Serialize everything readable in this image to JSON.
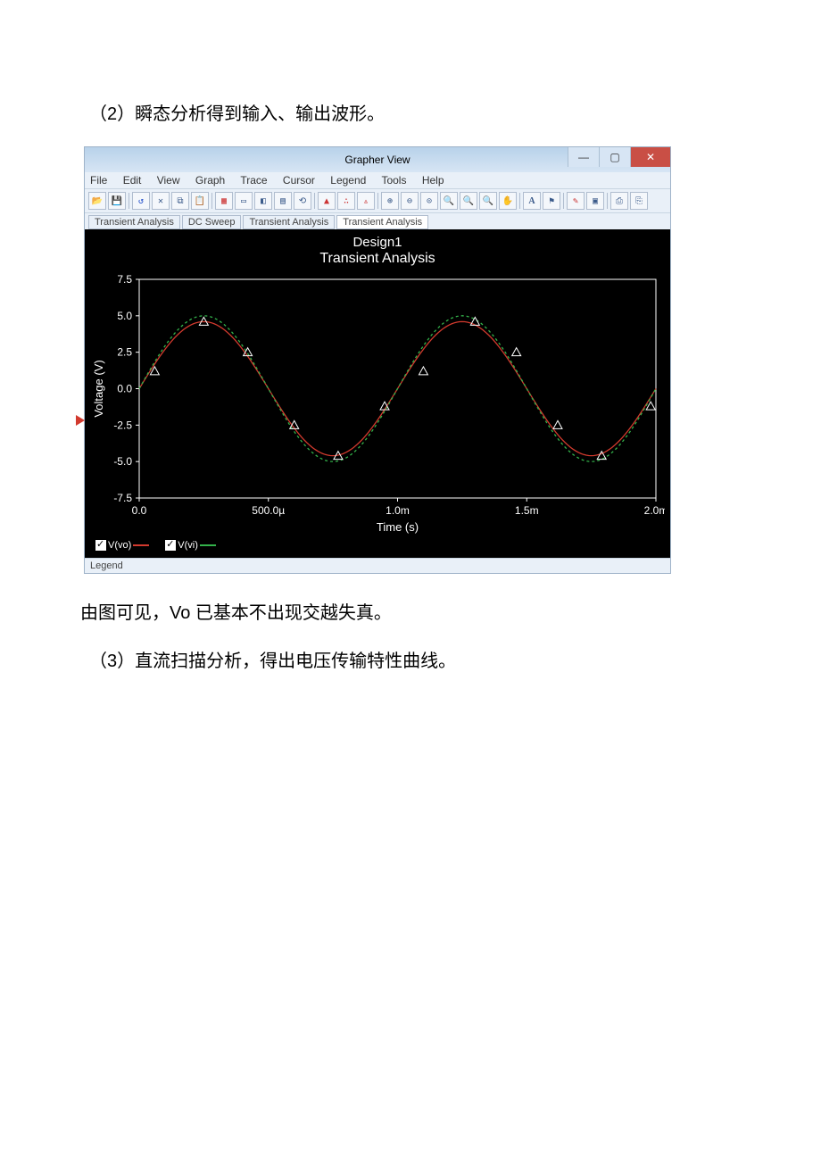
{
  "paragraphs": {
    "p1": "（2）瞬态分析得到输入、输出波形。",
    "p2": "由图可见，Vo 已基本不出现交越失真。",
    "p3": "（3）直流扫描分析，得出电压传输特性曲线。"
  },
  "window": {
    "title": "Grapher View",
    "min": "—",
    "max": "▢",
    "close": "✕",
    "menu": {
      "file": "File",
      "edit": "Edit",
      "view": "View",
      "graph": "Graph",
      "trace": "Trace",
      "cursor": "Cursor",
      "legend": "Legend",
      "tools": "Tools",
      "help": "Help"
    },
    "tabs": {
      "t1": "Transient Analysis",
      "t2": "DC Sweep",
      "t3": "Transient Analysis",
      "t4": "Transient Analysis"
    },
    "legend_status": "Legend"
  },
  "chart_data": {
    "type": "line",
    "title": "Design1",
    "subtitle": "Transient Analysis",
    "xlabel": "Time (s)",
    "ylabel": "Voltage (V)",
    "xlim": [
      0,
      0.002
    ],
    "ylim": [
      -7.5,
      7.5
    ],
    "xticks": {
      "values": [
        0,
        0.0005,
        0.001,
        0.0015,
        0.002
      ],
      "labels": [
        "0.0",
        "500.0µ",
        "1.0m",
        "1.5m",
        "2.0m"
      ]
    },
    "yticks": {
      "values": [
        -7.5,
        -5,
        -2.5,
        0,
        2.5,
        5,
        7.5
      ],
      "labels": [
        "-7.5",
        "-5.0",
        "-2.5",
        "0.0",
        "2.5",
        "5.0",
        "7.5"
      ]
    },
    "series": [
      {
        "name": "V(vo)",
        "color": "#d23a2e",
        "dashed": false,
        "x": [
          0,
          0.000125,
          0.00025,
          0.000375,
          0.0005,
          0.000625,
          0.00075,
          0.000875,
          0.001,
          0.001125,
          0.00125,
          0.001375,
          0.0015,
          0.001625,
          0.00175,
          0.001875,
          0.002
        ],
        "y": [
          0,
          3.3,
          4.6,
          3.3,
          0,
          -3.3,
          -4.6,
          -3.3,
          0,
          3.3,
          4.6,
          3.3,
          0,
          -3.3,
          -4.6,
          -3.3,
          0
        ]
      },
      {
        "name": "V(vi)",
        "color": "#33b24a",
        "dashed": true,
        "x": [
          0,
          0.000125,
          0.00025,
          0.000375,
          0.0005,
          0.000625,
          0.00075,
          0.000875,
          0.001,
          0.001125,
          0.00125,
          0.001375,
          0.0015,
          0.001625,
          0.00175,
          0.001875,
          0.002
        ],
        "y": [
          0,
          3.5,
          5.0,
          3.5,
          0,
          -3.5,
          -5.0,
          -3.5,
          0,
          3.5,
          5.0,
          3.5,
          0,
          -3.5,
          -5.0,
          -3.5,
          0
        ]
      }
    ],
    "markers": {
      "color": "#fff",
      "x": [
        6e-05,
        0.00025,
        0.00042,
        0.0006,
        0.00077,
        0.00095,
        0.0011,
        0.0013,
        0.00146,
        0.00162,
        0.00179,
        0.00198
      ],
      "y": [
        1.2,
        4.6,
        2.5,
        -2.5,
        -4.6,
        -1.2,
        1.2,
        4.6,
        2.5,
        -2.5,
        -4.6,
        -1.2
      ]
    }
  },
  "icons": {
    "open": "📂",
    "save": "💾",
    "undo": "↺",
    "del": "✕",
    "copy": "⧉",
    "paste": "📋",
    "grid": "▦",
    "box": "▭",
    "bw": "◧",
    "bw2": "▤",
    "reset": "⟲",
    "pk": "▲",
    "pts": "∴",
    "pk2": "▵",
    "zin": "⊕",
    "zout": "⊖",
    "zf": "⊙",
    "z1": "🔍",
    "z2": "🔍",
    "z3": "🔍",
    "hand": "✋",
    "txt": "A",
    "flag": "⚑",
    "mark": "✎",
    "ex1": "▣",
    "ex2": "⎙",
    "ex3": "⎘"
  }
}
